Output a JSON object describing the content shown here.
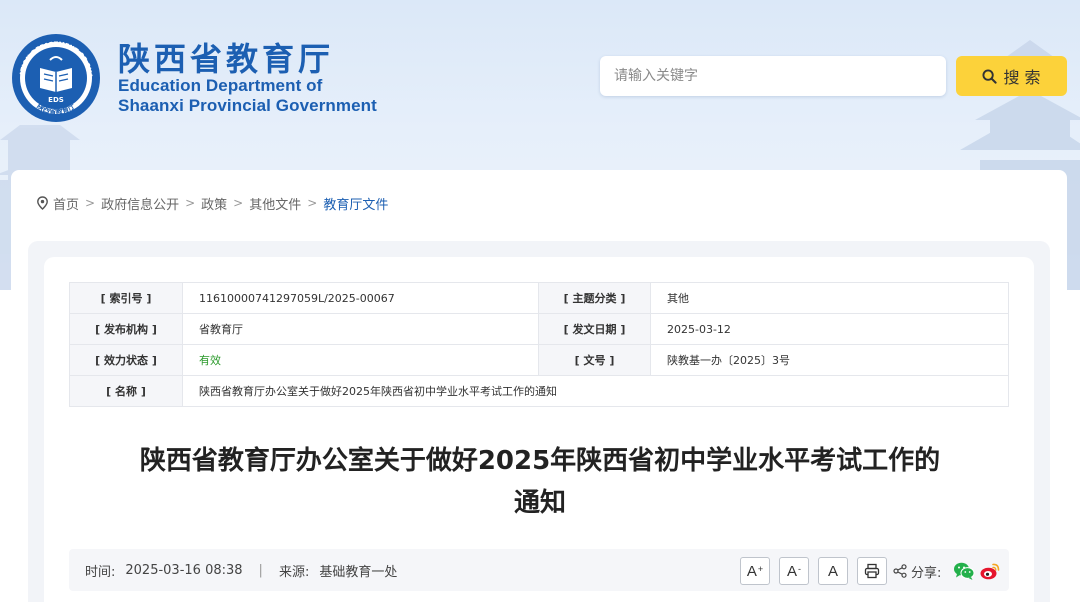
{
  "header": {
    "brand_cn": "陕西省教育厅",
    "brand_en_line1": "Education Department of",
    "brand_en_line2": "Shaanxi Provincial Government",
    "logo_ring_text": "EDUCATION DEPARTMENT OF SHAANXI",
    "logo_bottom_text": "陕西省教育厅",
    "logo_abbr": "EDS",
    "logo_icon": "open-book-emblem"
  },
  "search": {
    "placeholder": "请输入关键字",
    "button_label": "搜 索",
    "button_icon": "search-icon"
  },
  "breadcrumb": {
    "icon": "location-pin-icon",
    "items": [
      "首页",
      "政府信息公开",
      "政策",
      "其他文件"
    ],
    "current": "教育厅文件",
    "separator": ">"
  },
  "meta": {
    "index_label": "[ 索引号 ]",
    "index_value": "11610000741297059L/2025-00067",
    "topic_label": "[ 主题分类 ]",
    "topic_value": "其他",
    "issuer_label": "[ 发布机构 ]",
    "issuer_value": "省教育厅",
    "date_label": "[ 发文日期 ]",
    "date_value": "2025-03-12",
    "status_label": "[ 效力状态 ]",
    "status_value": "有效",
    "docno_label": "[ 文号 ]",
    "docno_value": "陕教基一办〔2025〕3号",
    "name_label": "[ 名称 ]",
    "name_value": "陕西省教育厅办公室关于做好2025年陕西省初中学业水平考试工作的通知"
  },
  "article": {
    "title_line1": "陕西省教育厅办公室关于做好2025年陕西省初中学业水平考试工作的",
    "title_line2": "通知"
  },
  "infobar": {
    "time_label": "时间:",
    "time_value": "2025-03-16 08:38",
    "separator": "|",
    "source_label": "来源:",
    "source_value": "基础教育一处",
    "font_larger": "A",
    "font_larger_sup": "+",
    "font_smaller": "A",
    "font_smaller_sup": "-",
    "font_reset": "A",
    "print_icon": "print-icon",
    "share_label": "分享:",
    "share_icon": "share-icon",
    "wechat_icon": "wechat-icon",
    "weibo_icon": "weibo-icon"
  },
  "colors": {
    "brand_blue": "#1c5fb2",
    "search_button": "#fcd23a",
    "status_green": "#2b9a2b",
    "wechat_green": "#23b04b",
    "weibo_red": "#e6162d"
  }
}
